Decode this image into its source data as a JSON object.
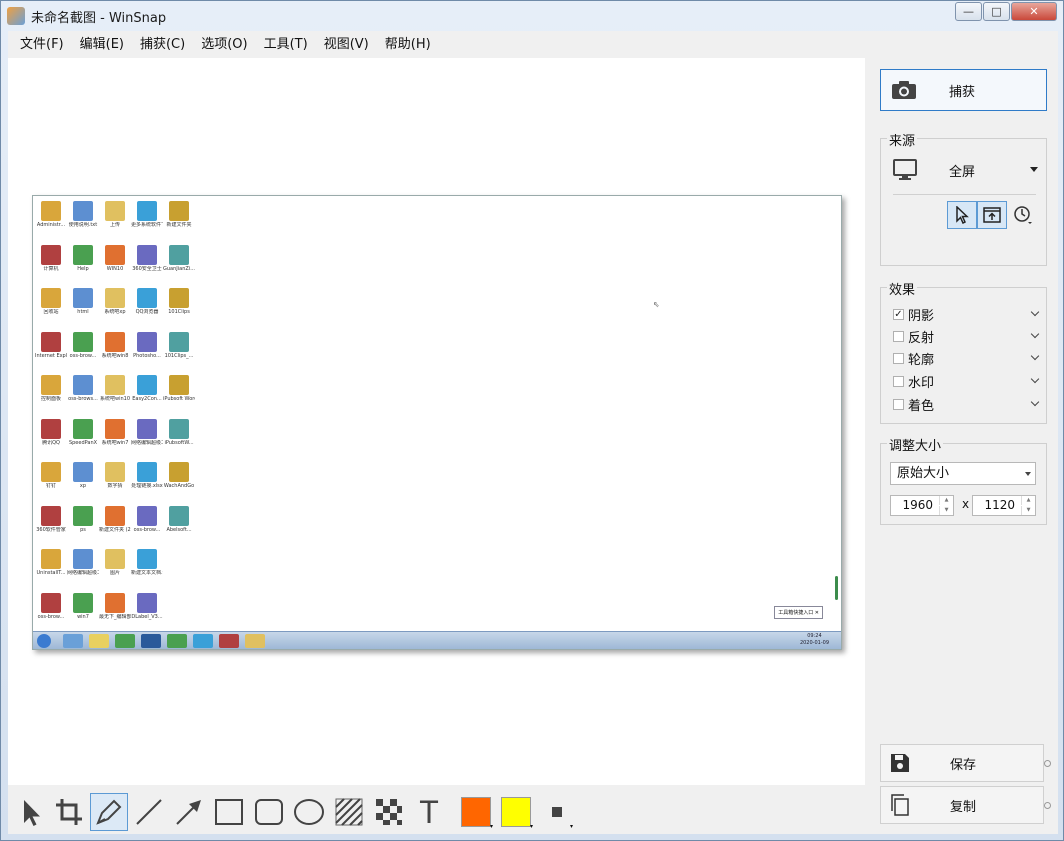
{
  "window": {
    "title": "未命名截图 - WinSnap",
    "minimize": "—",
    "maximize": "□",
    "close": "✕"
  },
  "menu": [
    "文件(F)",
    "编辑(E)",
    "捕获(C)",
    "选项(O)",
    "工具(T)",
    "视图(V)",
    "帮助(H)"
  ],
  "panel": {
    "capture_label": "捕获",
    "source": {
      "title": "来源",
      "value": "全屏",
      "modes": [
        "pointer-icon",
        "window-capture-icon",
        "timer-icon"
      ]
    },
    "effects": {
      "title": "效果",
      "items": [
        {
          "label": "阴影",
          "checked": true
        },
        {
          "label": "反射",
          "checked": false
        },
        {
          "label": "轮廓",
          "checked": false
        },
        {
          "label": "水印",
          "checked": false
        },
        {
          "label": "着色",
          "checked": false
        }
      ],
      "check_mark": "✓"
    },
    "resize": {
      "title": "调整大小",
      "mode": "原始大小",
      "width": "1960",
      "height": "1120",
      "x_label": "x"
    },
    "save_label": "保存",
    "copy_label": "复制"
  },
  "screenshot": {
    "desktop_icons": [
      [
        "Administr...",
        "使用说明.txt",
        "上传",
        "更多系统软件下载.html",
        "新建文件夹"
      ],
      [
        "计算机",
        "Help",
        "WIN10",
        "360安全卫士",
        "GuanJianZi..."
      ],
      [
        "回收站",
        "html",
        "系统吧xp",
        "QQ浏览器",
        "101Clips"
      ],
      [
        "Internet Explorer",
        "oss-brow...",
        "系统吧win8",
        "Photosho...",
        "101Clips_..."
      ],
      [
        "控制面板",
        "oss-brows...",
        "系统吧win10",
        "Easy2Con...",
        "iPubsoft Word t..."
      ],
      [
        "腾讯QQ",
        "SpeedPanX",
        "系统吧win7",
        "网络编辑超级工具箱.exe",
        "iPubsoftW..."
      ],
      [
        "钉钉",
        "xp",
        "数字猜",
        "处理链接.xlsx",
        "WachAndGo"
      ],
      [
        "360软件管家",
        "ps",
        "新建文件夹 (2)",
        "oss-brow...",
        "Abelsoft..."
      ],
      [
        "UninstallT...",
        "网络编辑超级工具箱_整...",
        "图片",
        "新建文本文档.txt",
        ""
      ],
      [
        "oss-brow...",
        "win7",
        "最无下_编辑部_ 沟通推.txt",
        "DLabel_V3...",
        ""
      ]
    ],
    "popup_text": "工具箱快捷入口 ✕",
    "clock_time": "09:24",
    "clock_date": "2020-01-09"
  },
  "toolbar": {
    "tools": [
      "select-tool-icon",
      "crop-tool-icon",
      "pen-tool-icon",
      "line-tool-icon",
      "arrow-tool-icon",
      "rectangle-tool-icon",
      "rounded-rectangle-tool-icon",
      "ellipse-tool-icon",
      "hatch-tool-icon",
      "pixelate-tool-icon",
      "text-tool-icon"
    ],
    "fill_color": "#ff6600",
    "outline_color": "#ffff00",
    "text_tool_glyph": "T",
    "dropdown_glyph": "▾"
  }
}
